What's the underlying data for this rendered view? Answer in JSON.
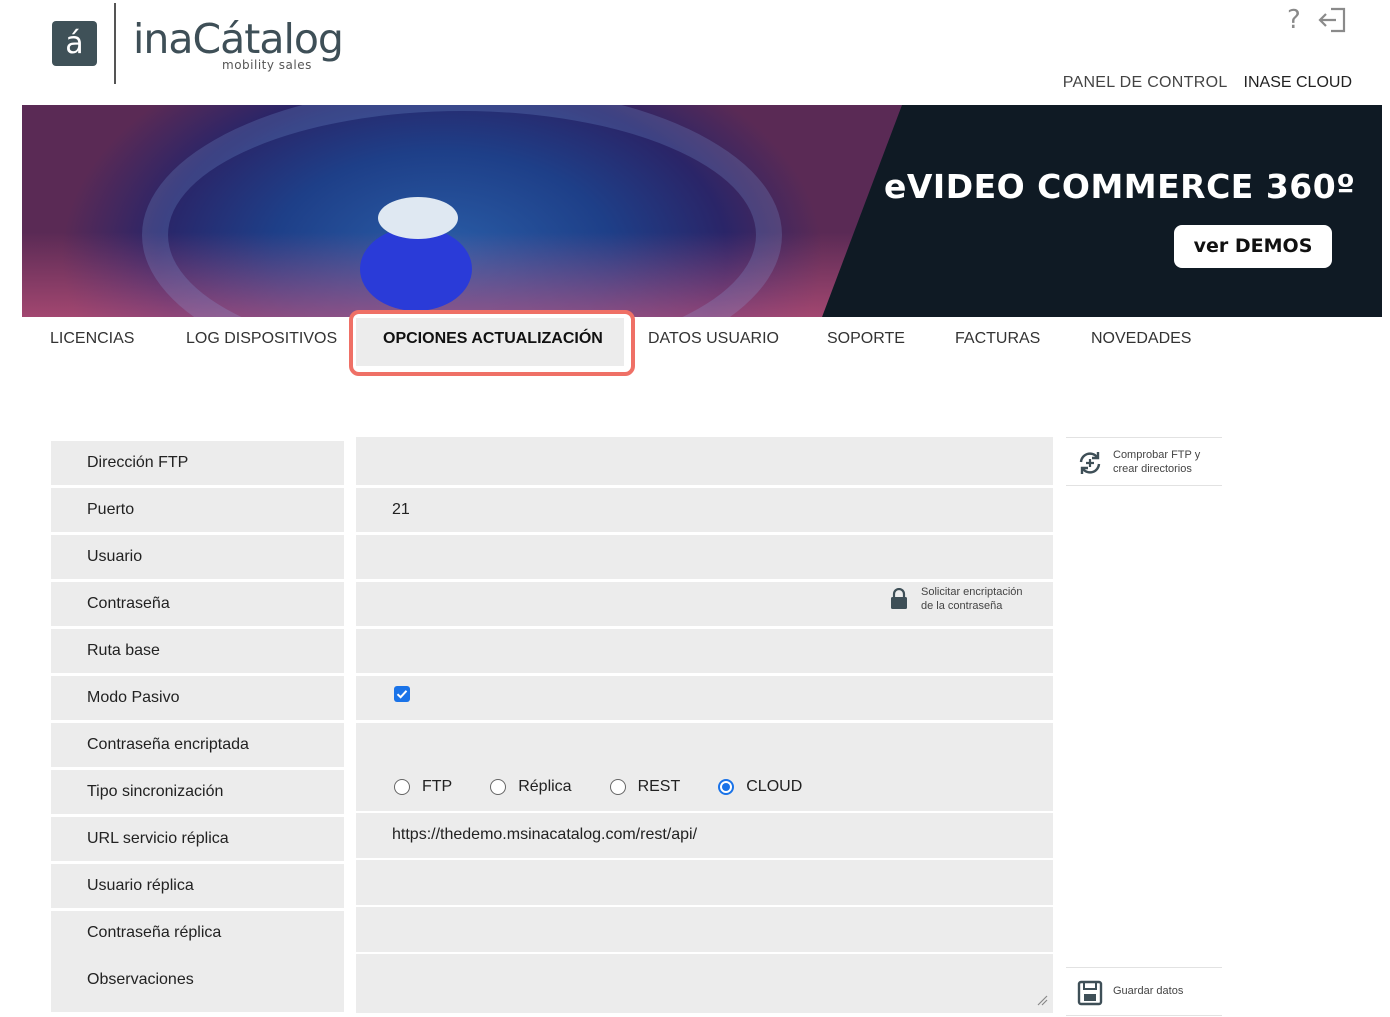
{
  "header": {
    "logo_letter": "á",
    "brand_name": "inaCátalog",
    "brand_subtitle": "mobility sales",
    "help_symbol": "?",
    "links": [
      "PANEL DE CONTROL",
      "INASE CLOUD"
    ]
  },
  "banner": {
    "title": "eVIDEO COMMERCE 360º",
    "button_label": "ver DEMOS"
  },
  "tabs": [
    {
      "label": "LICENCIAS"
    },
    {
      "label": "LOG DISPOSITIVOS"
    },
    {
      "label": "OPCIONES ACTUALIZACIÓN",
      "active": true
    },
    {
      "label": "DATOS USUARIO"
    },
    {
      "label": "SOPORTE"
    },
    {
      "label": "FACTURAS"
    },
    {
      "label": "NOVEDADES"
    }
  ],
  "form": {
    "rows": [
      {
        "label": "Dirección FTP",
        "value": ""
      },
      {
        "label": "Puerto",
        "value": "21"
      },
      {
        "label": "Usuario",
        "value": ""
      },
      {
        "label": "Contraseña",
        "value": ""
      },
      {
        "label": "Ruta base",
        "value": ""
      },
      {
        "label": "Modo Pasivo",
        "value": ""
      },
      {
        "label": "Contraseña encriptada",
        "value": ""
      },
      {
        "label": "Tipo sincronización",
        "value": ""
      },
      {
        "label": "URL servicio réplica",
        "value": "https://thedemo.msinacatalog.com/rest/api/"
      },
      {
        "label": "Usuario réplica",
        "value": ""
      },
      {
        "label": "Contraseña réplica",
        "value": ""
      },
      {
        "label": "Observaciones",
        "value": ""
      }
    ],
    "encrypt_hint": [
      "Solicitar encriptación",
      "de la contraseña"
    ],
    "passive_mode_checked": true,
    "sync_options": [
      {
        "label": "FTP",
        "selected": false
      },
      {
        "label": "Réplica",
        "selected": false
      },
      {
        "label": "REST",
        "selected": false
      },
      {
        "label": "CLOUD",
        "selected": true
      }
    ]
  },
  "side": {
    "check_ftp": [
      "Comprobar FTP y",
      "crear directorios"
    ],
    "save": "Guardar datos"
  },
  "colors": {
    "accent": "#1a73e8",
    "tab_highlight": "#ef7066",
    "row_bg": "#ececec",
    "logo_bg": "#3f5158"
  }
}
